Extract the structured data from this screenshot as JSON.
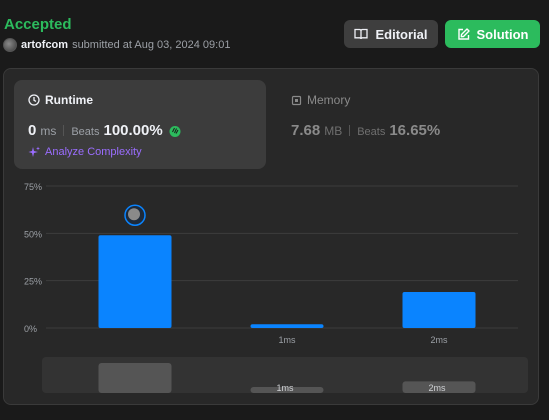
{
  "header": {
    "status": "Accepted",
    "user": "artofcom",
    "submitted_text": "submitted at Aug 03, 2024 09:01"
  },
  "buttons": {
    "editorial": "Editorial",
    "solution": "Solution"
  },
  "runtime": {
    "title": "Runtime",
    "value": "0",
    "unit": "ms",
    "beats_label": "Beats",
    "beats_value": "100.00%",
    "analyze": "Analyze Complexity"
  },
  "memory": {
    "title": "Memory",
    "value": "7.68",
    "unit": "MB",
    "beats_label": "Beats",
    "beats_value": "16.65%"
  },
  "colors": {
    "accent_green": "#2cbb5d",
    "bar_blue": "#0a84ff",
    "analyze_purple": "#9b6dff"
  },
  "chart_data": {
    "type": "bar",
    "categories": [
      "",
      "1ms",
      "2ms"
    ],
    "values": [
      49,
      2,
      19
    ],
    "y_ticks": [
      "0%",
      "25%",
      "50%",
      "75%"
    ],
    "ylim": [
      0,
      75
    ],
    "grid": true,
    "overview_labels": [
      "",
      "1ms",
      "2ms"
    ]
  }
}
